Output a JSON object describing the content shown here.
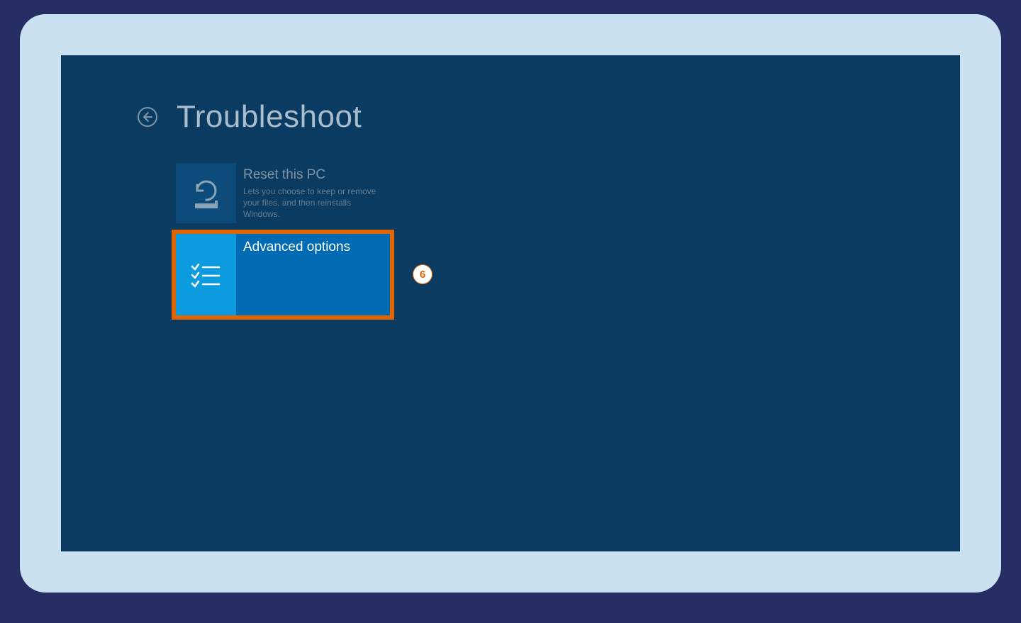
{
  "page_title": "Troubleshoot",
  "tiles": {
    "reset": {
      "title": "Reset this PC",
      "desc": "Lets you choose to keep or remove your files, and then reinstalls Windows."
    },
    "advanced": {
      "title": "Advanced options"
    }
  },
  "callout": {
    "number": "6"
  },
  "colors": {
    "page_bg": "#262d62",
    "frame_bg": "#c9e1f1",
    "screen_bg": "#0b3b61",
    "highlight_border": "#e06400",
    "selected_tile": "#006bb3",
    "selected_icon": "#0d9bdf"
  }
}
